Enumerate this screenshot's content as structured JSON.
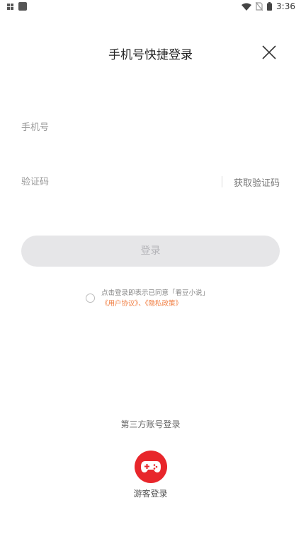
{
  "status_bar": {
    "time": "3:36"
  },
  "header": {
    "title": "手机号快捷登录"
  },
  "form": {
    "phone_placeholder": "手机号",
    "code_placeholder": "验证码",
    "get_code_label": "获取验证码",
    "login_label": "登录"
  },
  "agreement": {
    "text": "点击登录即表示已同意「看豆小说」",
    "user_agreement": "《用户协议》",
    "separator": "、",
    "privacy_policy": "《隐私政策》"
  },
  "third_party": {
    "title": "第三方账号登录",
    "guest_label": "游客登录"
  },
  "colors": {
    "accent": "#f07a3c",
    "guest_icon_bg": "#e8262b",
    "button_disabled_bg": "#e6e6e8"
  }
}
